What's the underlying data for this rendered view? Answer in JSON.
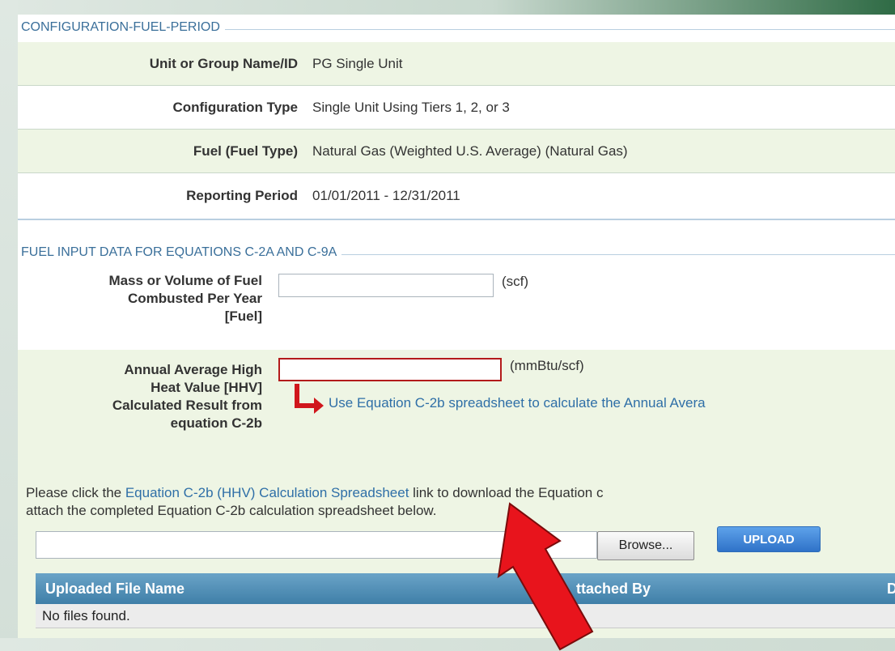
{
  "config": {
    "section_title": "CONFIGURATION-FUEL-PERIOD",
    "rows": [
      {
        "label": "Unit or Group Name/ID",
        "value": "PG Single Unit"
      },
      {
        "label": "Configuration Type",
        "value": "Single Unit Using Tiers 1, 2, or 3"
      },
      {
        "label": "Fuel (Fuel Type)",
        "value": "Natural Gas (Weighted U.S. Average) (Natural Gas)"
      },
      {
        "label": "Reporting Period",
        "value": "01/01/2011 - 12/31/2011"
      }
    ]
  },
  "fuel_input": {
    "section_title": "FUEL INPUT DATA FOR EQUATIONS C-2A AND C-9A",
    "mass_volume": {
      "label_lines": [
        "Mass or Volume of Fuel",
        "Combusted Per Year",
        "[Fuel]"
      ],
      "value": "",
      "unit": "(scf)"
    },
    "hhv": {
      "label_lines": [
        "Annual Average High",
        "Heat Value [HHV]",
        "Calculated Result from",
        "equation C-2b"
      ],
      "value": "",
      "unit": "(mmBtu/scf)",
      "link": "Use Equation C-2b spreadsheet to calculate the Annual Avera"
    }
  },
  "instructions": {
    "line1_prefix": "Please click the ",
    "line1_link": "Equation C-2b (HHV) Calculation Spreadsheet",
    "line1_suffix": " link to download the Equation c",
    "line2": "attach the completed Equation C-2b calculation spreadsheet below."
  },
  "upload": {
    "file_value": "",
    "browse_label": "Browse...",
    "upload_label": "UPLOAD"
  },
  "files_table": {
    "headers": [
      "Uploaded File Name",
      "ttached By",
      "D"
    ],
    "empty_message": "No files found."
  },
  "annotation": {
    "arrow_color": "#e8141c"
  }
}
